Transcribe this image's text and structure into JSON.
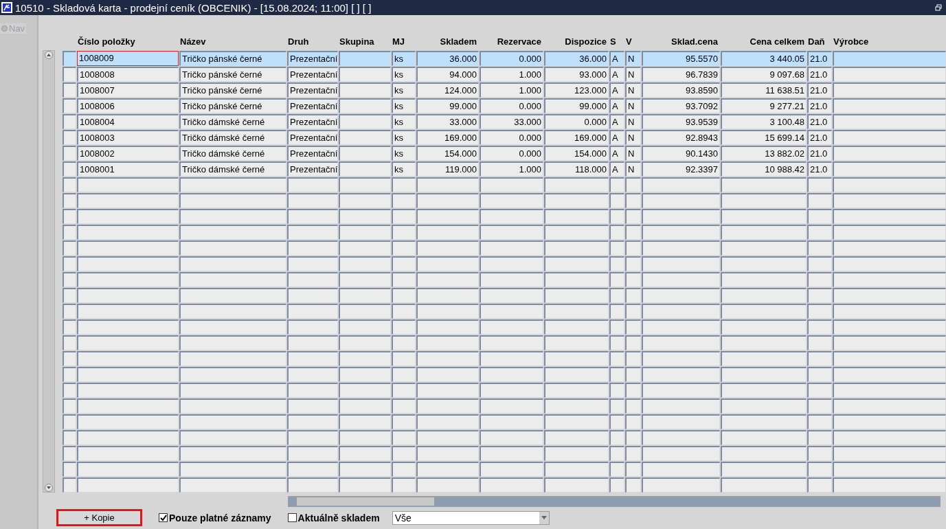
{
  "window": {
    "title": "10510 - Skladová karta - prodejní ceník (OBCENIK) - [15.08.2024; 11:00]  [ ]  [ ]"
  },
  "sidebar": {
    "items": [
      {
        "label": "Nav",
        "selected": false
      }
    ]
  },
  "table": {
    "columns": [
      {
        "label": "Číslo položky",
        "kind": "text"
      },
      {
        "label": "Název",
        "kind": "text"
      },
      {
        "label": "Druh",
        "kind": "text"
      },
      {
        "label": "Skupina",
        "kind": "text"
      },
      {
        "label": "MJ",
        "kind": "text"
      },
      {
        "label": "Skladem",
        "kind": "number"
      },
      {
        "label": "Rezervace",
        "kind": "number"
      },
      {
        "label": "Dispozice",
        "kind": "number"
      },
      {
        "label": "S",
        "kind": "text"
      },
      {
        "label": "V",
        "kind": "text"
      },
      {
        "label": "Sklad.cena",
        "kind": "number"
      },
      {
        "label": "Cena celkem",
        "kind": "number"
      },
      {
        "label": "Daň",
        "kind": "text"
      },
      {
        "label": "Výrobce",
        "kind": "text"
      }
    ],
    "rows": [
      {
        "selected": true,
        "cells": [
          "1008009",
          "Tričko pánské černé",
          "Prezentační",
          "",
          "ks",
          "36.000",
          "0.000",
          "36.000",
          "A",
          "N",
          "95.5570",
          "3 440.05",
          "21.0",
          ""
        ]
      },
      {
        "selected": false,
        "cells": [
          "1008008",
          "Tričko pánské černé",
          "Prezentační",
          "",
          "ks",
          "94.000",
          "1.000",
          "93.000",
          "A",
          "N",
          "96.7839",
          "9 097.68",
          "21.0",
          ""
        ]
      },
      {
        "selected": false,
        "cells": [
          "1008007",
          "Tričko pánské černé",
          "Prezentační",
          "",
          "ks",
          "124.000",
          "1.000",
          "123.000",
          "A",
          "N",
          "93.8590",
          "11 638.51",
          "21.0",
          ""
        ]
      },
      {
        "selected": false,
        "cells": [
          "1008006",
          "Tričko pánské černé",
          "Prezentační",
          "",
          "ks",
          "99.000",
          "0.000",
          "99.000",
          "A",
          "N",
          "93.7092",
          "9 277.21",
          "21.0",
          ""
        ]
      },
      {
        "selected": false,
        "cells": [
          "1008004",
          "Tričko dámské černé",
          "Prezentační",
          "",
          "ks",
          "33.000",
          "33.000",
          "0.000",
          "A",
          "N",
          "93.9539",
          "3 100.48",
          "21.0",
          ""
        ]
      },
      {
        "selected": false,
        "cells": [
          "1008003",
          "Tričko dámské černé",
          "Prezentační",
          "",
          "ks",
          "169.000",
          "0.000",
          "169.000",
          "A",
          "N",
          "92.8943",
          "15 699.14",
          "21.0",
          ""
        ]
      },
      {
        "selected": false,
        "cells": [
          "1008002",
          "Tričko dámské černé",
          "Prezentační",
          "",
          "ks",
          "154.000",
          "0.000",
          "154.000",
          "A",
          "N",
          "90.1430",
          "13 882.02",
          "21.0",
          ""
        ]
      },
      {
        "selected": false,
        "cells": [
          "1008001",
          "Tričko dámské černé",
          "Prezentační",
          "",
          "ks",
          "119.000",
          "1.000",
          "118.000",
          "A",
          "N",
          "92.3397",
          "10 988.42",
          "21.0",
          ""
        ]
      }
    ]
  },
  "footer": {
    "button": {
      "label": "+ Kopie",
      "highlighted": true
    },
    "checkboxes": [
      {
        "label": "Pouze platné záznamy",
        "checked": true
      },
      {
        "label": "Aktuálně skladem",
        "checked": false
      }
    ],
    "select": {
      "value": "Vše"
    }
  }
}
